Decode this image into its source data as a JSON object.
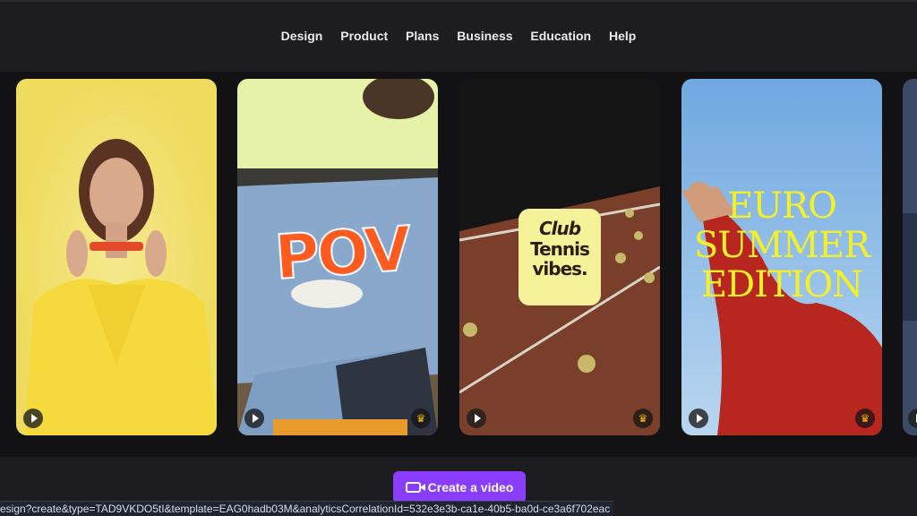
{
  "nav": {
    "items": [
      "Design",
      "Product",
      "Plans",
      "Business",
      "Education",
      "Help"
    ]
  },
  "cards": {
    "pov": {
      "title": "POV"
    },
    "club": {
      "line1": "Club",
      "line2": "Tennis",
      "line3": "vibes."
    },
    "euro": {
      "line1": "EURO",
      "line2": "SUMMER",
      "line3": "EDITION"
    }
  },
  "icons": {
    "play": "play-icon",
    "crown": "crown-icon",
    "video": "video-camera-icon"
  },
  "cta": {
    "label": "Create a video"
  },
  "status_bar": {
    "url": "esign?create&type=TAD9VKDO5tI&template=EAG0hadb03M&analyticsCorrelationId=532e3e3b-ca1e-40b5-ba0d-ce3a6f702eac"
  },
  "colors": {
    "accent": "#8b3dff",
    "crown": "#f2b705"
  }
}
